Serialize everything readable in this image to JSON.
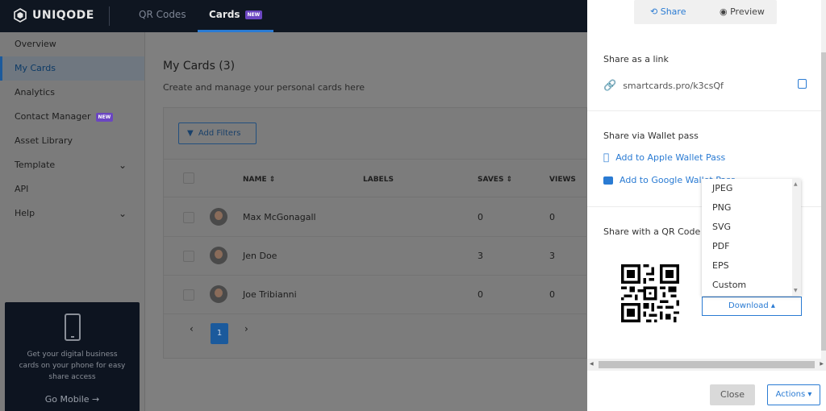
{
  "brand": {
    "name": "UNIQODE"
  },
  "topnav": {
    "tabs": [
      {
        "label": "QR Codes"
      },
      {
        "label": "Cards",
        "badge": "NEW"
      }
    ]
  },
  "sidebar": {
    "items": [
      {
        "label": "Overview"
      },
      {
        "label": "My Cards"
      },
      {
        "label": "Analytics"
      },
      {
        "label": "Contact Manager",
        "badge": "NEW"
      },
      {
        "label": "Asset Library"
      },
      {
        "label": "Template"
      },
      {
        "label": "API"
      },
      {
        "label": "Help"
      }
    ],
    "promo": {
      "text": "Get your digital business cards on your phone for easy share access",
      "link": "Go Mobile →"
    }
  },
  "main": {
    "title": "My Cards (3)",
    "subtitle": "Create and manage your personal cards here",
    "filter_label": "Add Filters",
    "columns": {
      "name": "NAME",
      "labels": "LABELS",
      "saves": "SAVES",
      "views": "VIEWS"
    },
    "sort_icon": "⇕",
    "rows": [
      {
        "name": "Max McGonagall",
        "saves": "0",
        "views": "0"
      },
      {
        "name": "Jen Doe",
        "saves": "3",
        "views": "3"
      },
      {
        "name": "Joe Tribianni",
        "saves": "0",
        "views": "0"
      }
    ],
    "pagination": {
      "prev": "‹",
      "current": "1",
      "next": "›"
    }
  },
  "drawer": {
    "toggle": {
      "share": "Share",
      "preview": "Preview"
    },
    "share_link": {
      "title": "Share as a link",
      "url": "smartcards.pro/k3csQf"
    },
    "wallet": {
      "title": "Share via Wallet pass",
      "apple": "Add to Apple Wallet Pass",
      "google": "Add to Google Wallet Pass"
    },
    "qr": {
      "title": "Share with a QR Code",
      "download": "Download ▴"
    },
    "formats": [
      "JPEG",
      "PNG",
      "SVG",
      "PDF",
      "EPS",
      "Custom"
    ],
    "footer": {
      "close": "Close",
      "actions": "Actions ▾"
    }
  },
  "colors": {
    "accent": "#2a7bd3",
    "badge": "#6b46c1",
    "topbar": "#0f1621"
  }
}
